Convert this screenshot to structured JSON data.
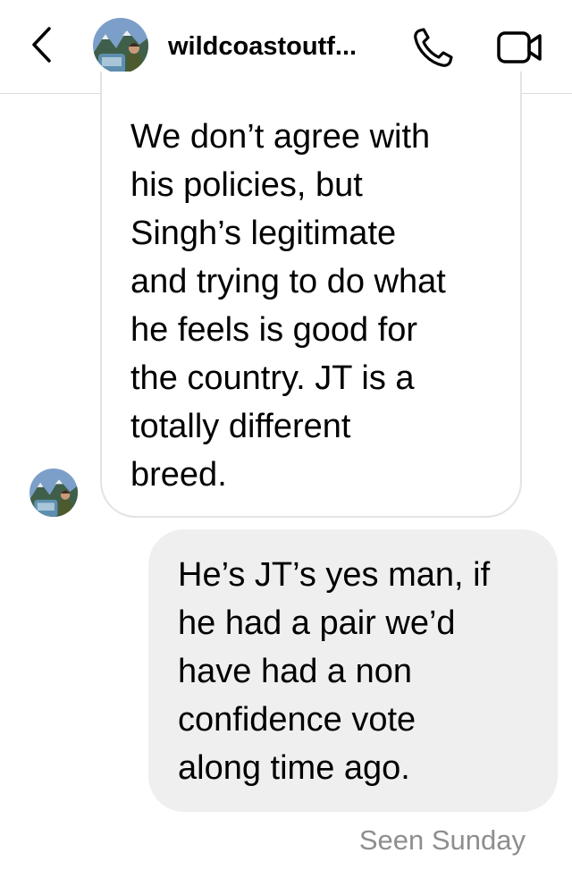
{
  "header": {
    "title": "wildcoastoutf...",
    "back_icon": "chevron-left-icon",
    "call_icon": "phone-icon",
    "video_icon": "video-camera-icon"
  },
  "messages": [
    {
      "direction": "incoming",
      "text": "We don’t agree with\nhis policies, but\nSingh’s legitimate\nand trying to do what\nhe feels is good for\nthe country. JT is a\ntotally different\nbreed."
    },
    {
      "direction": "outgoing",
      "text": "He’s JT’s yes man, if\nhe had a pair we’d\nhave had a non\nconfidence vote\nalong time ago."
    }
  ],
  "status": {
    "seen": "Seen Sunday"
  },
  "colors": {
    "outgoing_bubble": "#efefef",
    "incoming_border": "#e3e3e3",
    "seen_text": "#8e8e8e"
  }
}
